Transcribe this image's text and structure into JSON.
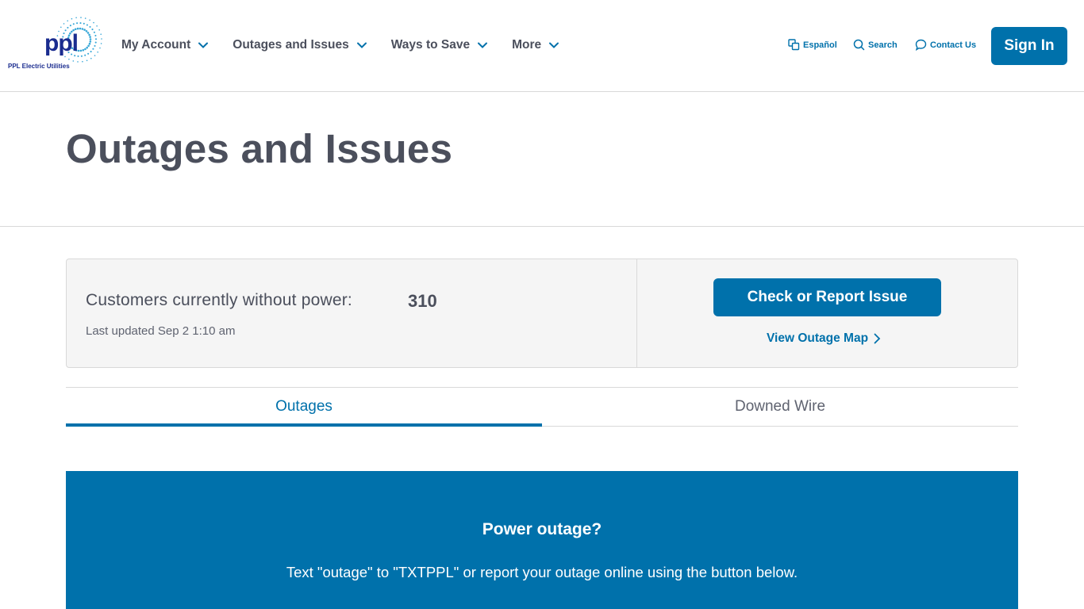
{
  "header": {
    "logo": {
      "wordmark": "ppl",
      "tagline": "PPL Electric Utilities",
      "brand_color": "#1a2c8f",
      "spark_color": "#3aa8d8"
    },
    "nav": [
      {
        "label": "My Account",
        "icon": "chevron-down-icon"
      },
      {
        "label": "Outages and Issues",
        "icon": "chevron-down-icon"
      },
      {
        "label": "Ways to Save",
        "icon": "chevron-down-icon"
      },
      {
        "label": "More",
        "icon": "chevron-down-icon"
      }
    ],
    "utility": {
      "language": {
        "label": "Español",
        "icon": "translate-icon"
      },
      "search": {
        "label": "Search",
        "icon": "search-icon"
      },
      "contact": {
        "label": "Contact Us",
        "icon": "chat-bubble-icon"
      }
    },
    "sign_in": "Sign In"
  },
  "page": {
    "title": "Outages and Issues"
  },
  "status": {
    "customers_label": "Customers currently without power:",
    "customers_count": "310",
    "last_updated": "Last updated Sep 2 1:10 am",
    "report_button": "Check or Report Issue",
    "map_link": "View Outage Map"
  },
  "tabs": [
    {
      "label": "Outages",
      "active": true
    },
    {
      "label": "Downed Wire",
      "active": false
    }
  ],
  "banner": {
    "title": "Power outage?",
    "text": "Text \"outage\" to \"TXTPPL\" or report your outage online using the button below."
  },
  "colors": {
    "accent": "#0071ab",
    "text": "#4b4f5c",
    "panel": "#f5f5f5",
    "border": "#d9d9d9"
  }
}
